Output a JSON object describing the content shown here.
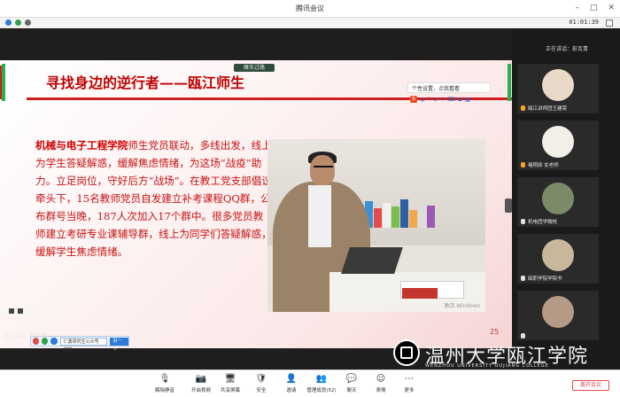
{
  "window": {
    "title": "腾讯会议"
  },
  "infobar": {
    "timer": "01:01:39"
  },
  "presenter_tag": "雁东过路",
  "slide": {
    "title": "寻找身边的逆行者——瓯江师生",
    "body_highlight": "机械与电子工程学院",
    "body_text": "师生党员联动，多线出发，线上为学生答疑解惑，缓解焦虑情绪，为这场“战疫”助力。立足岗位，守好后方“战场”。在教工党支部倡议牵头下，15名教师党员自发建立补考课程QQ群，公布群号当晚，187人次加入17个群中。很多党员教师建立考研专业课辅导群，线上为同学们答疑解惑，缓解学生焦虑情绪。",
    "page_number": "25",
    "photo_watermark": "激活 Windows"
  },
  "ime": {
    "tooltip": "个性设置，点我看看",
    "logo": "S",
    "items": [
      "中",
      "°",
      "⊙",
      "✎",
      "⌨",
      "♟",
      "▦"
    ]
  },
  "speaking": "正在讲话：彭克青",
  "taskbar": {
    "tab1": "仁勇研究生公众号编辑",
    "tab2": "另一下"
  },
  "panel": {
    "title": "正在讲话：彭克青",
    "tiles": [
      {
        "name": "瓯江讲师团王建荣",
        "pic_color": "#e9d9c8",
        "mic": "on"
      },
      {
        "name": "褚翔辰 女老师",
        "pic_color": "#f2efe9",
        "mic": "on"
      },
      {
        "name": "机电团学微校",
        "pic_color": "#7c8a6a",
        "mic": "off"
      },
      {
        "name": "瓯职学院学院书",
        "pic_color": "#c9b79c",
        "mic": "off"
      },
      {
        "name": "",
        "pic_color": "#b59a86",
        "mic": "off"
      }
    ]
  },
  "toolbar": {
    "items": [
      {
        "label": "解除静音",
        "icon": "🎙"
      },
      {
        "label": "开启视频",
        "icon": "📷"
      },
      {
        "label": "共享屏幕",
        "icon": "🖥"
      },
      {
        "label": "安全",
        "icon": "🛡"
      },
      {
        "label": "邀请",
        "icon": "👤"
      },
      {
        "label": "管理成员(52)",
        "icon": "👥"
      },
      {
        "label": "聊天",
        "icon": "💬"
      },
      {
        "label": "表情",
        "icon": "☺"
      },
      {
        "label": "更多",
        "icon": "⋯"
      }
    ],
    "leave": "离开会议"
  },
  "overlay": {
    "school_name": "温州大学瓯江学院",
    "school_sub": "WENZHOU UNIVERSITY OUJIANG COLLEGE"
  }
}
